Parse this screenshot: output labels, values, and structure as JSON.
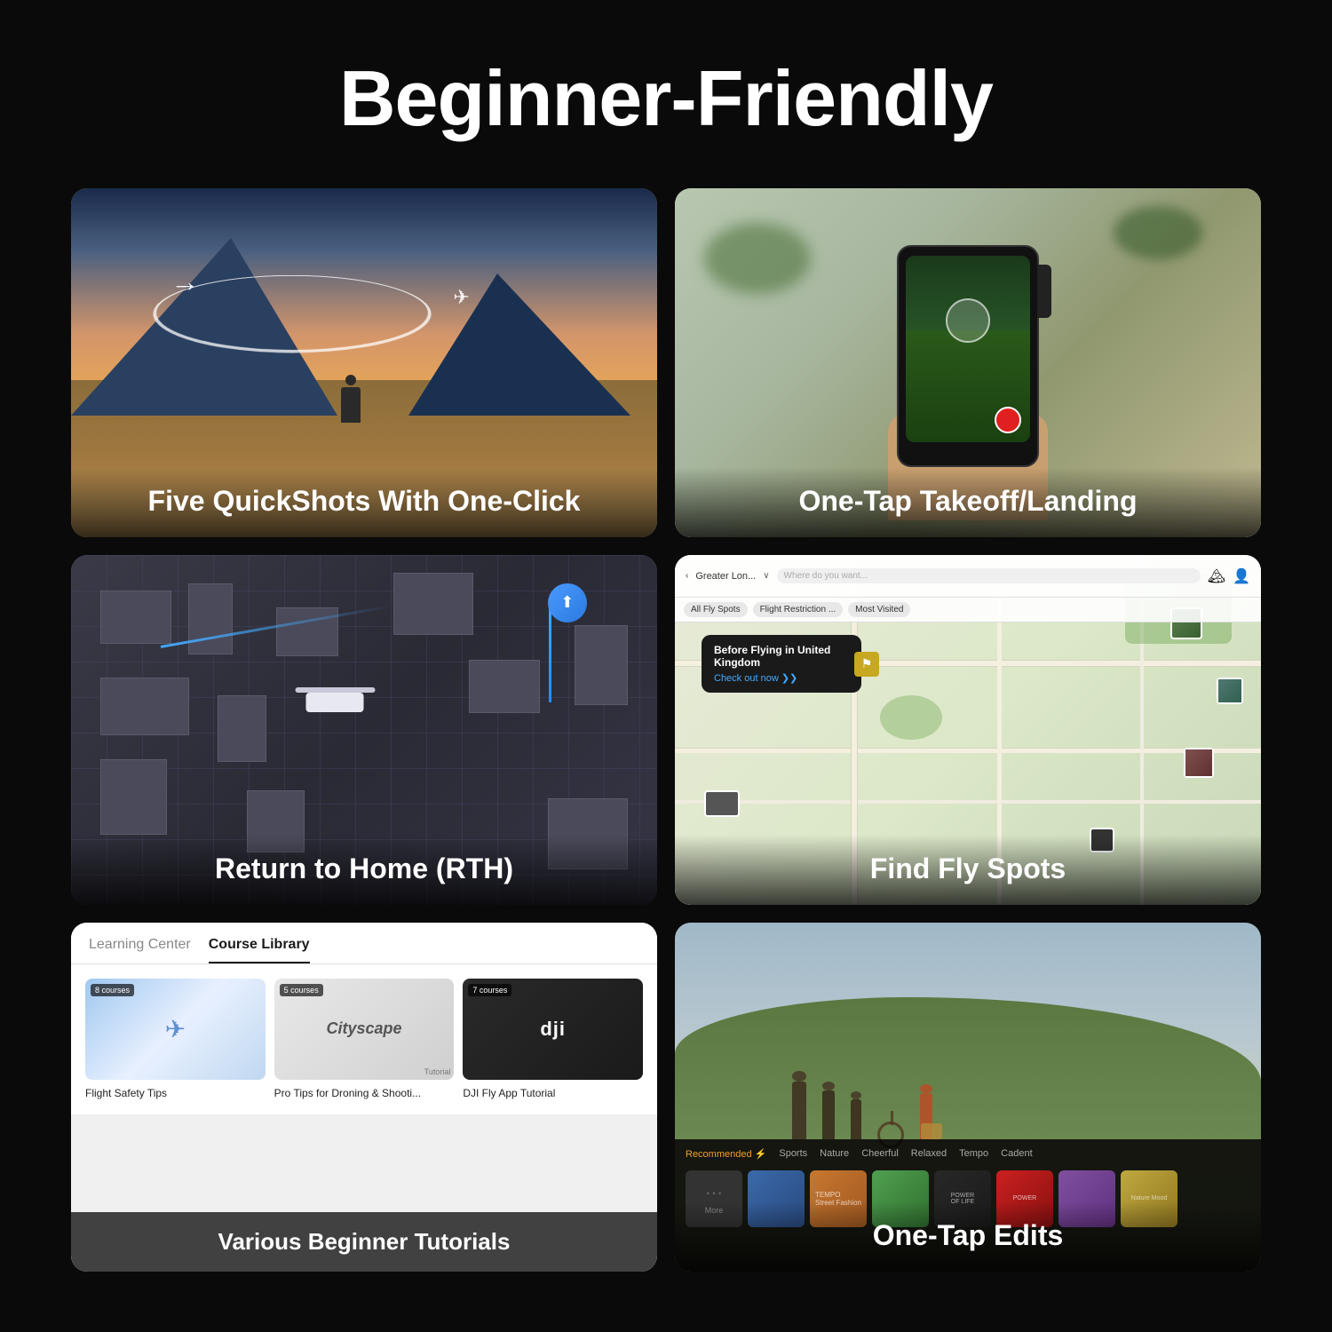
{
  "page": {
    "title": "Beginner-Friendly",
    "background": "#0a0a0a"
  },
  "cards": [
    {
      "id": "quickshots",
      "title": "Five QuickShots With One-Click"
    },
    {
      "id": "takeoff",
      "title": "One-Tap Takeoff/Landing"
    },
    {
      "id": "rth",
      "title": "Return to Home (RTH)"
    },
    {
      "id": "flyspots",
      "title": "Find Fly Spots"
    },
    {
      "id": "tutorials",
      "title": "Various Beginner Tutorials"
    },
    {
      "id": "edits",
      "title": "One-Tap Edits"
    }
  ],
  "tutorials": {
    "tab_learning": "Learning Center",
    "tab_courses": "Course Library",
    "courses": [
      {
        "badge": "8 courses",
        "name": "Flight Safety Tips"
      },
      {
        "badge": "5 courses",
        "name": "Pro Tips for Droning & Shooti..."
      },
      {
        "badge": "7 courses",
        "name": "DJI Fly App Tutorial"
      }
    ],
    "course2_title": "Cityscape"
  },
  "flyspots": {
    "header_title": "Greater Lon...",
    "tab1": "All Fly Spots",
    "tab2": "Flight Restriction ...",
    "tab3": "Most Visited",
    "popup_title": "Before Flying in United Kingdom",
    "popup_link": "Check out now ❯❯"
  },
  "edits": {
    "tabs": [
      "Recommended ⚡",
      "Sports",
      "Nature",
      "Cheerful",
      "Relaxed",
      "Tempo",
      "Cadent"
    ],
    "more_label": "More"
  }
}
